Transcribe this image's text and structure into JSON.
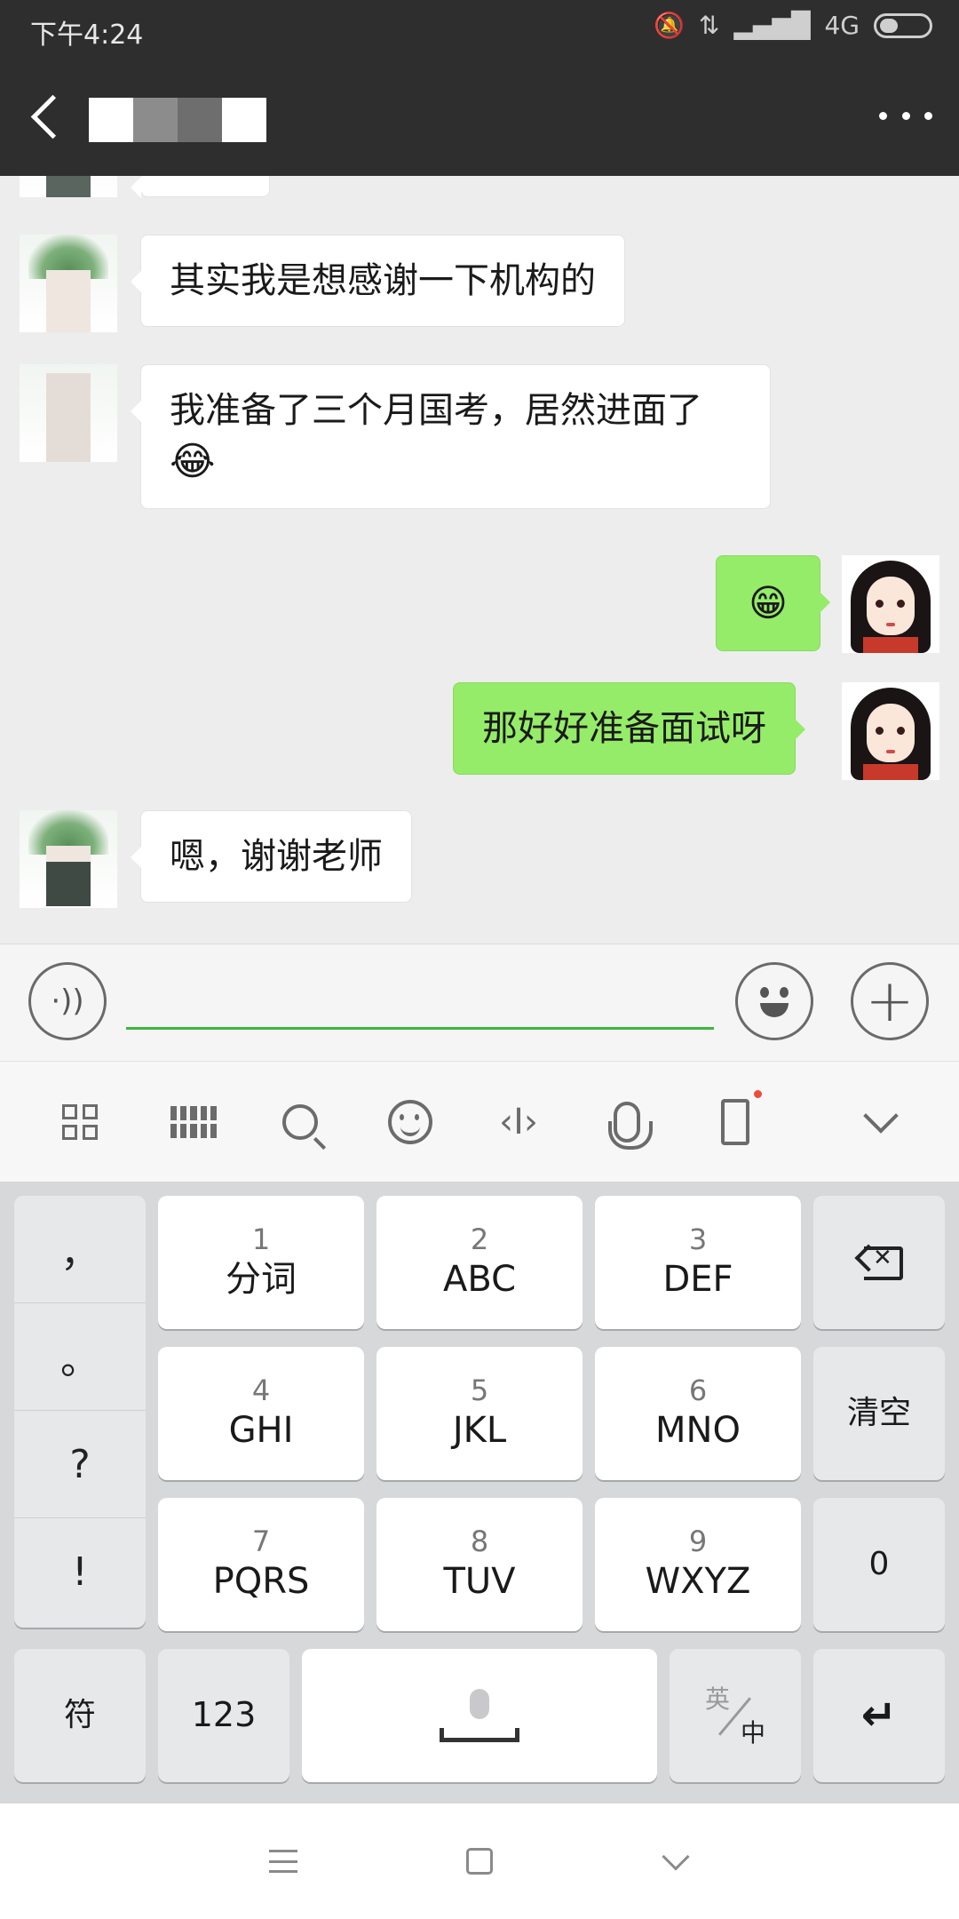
{
  "status_bar": {
    "time": "下午4:24",
    "network": "4G"
  },
  "title_bar": {
    "contact_name": "",
    "back_icon": "back-arrow-icon",
    "more_icon": "more-dots-icon"
  },
  "messages": [
    {
      "side": "left",
      "text": "其实我是想感谢一下机构的"
    },
    {
      "side": "left",
      "text": "我准备了三个月国考，居然进面了",
      "emoji": "😂"
    },
    {
      "side": "right",
      "text": "",
      "emoji": "😁"
    },
    {
      "side": "right",
      "text": "那好好准备面试呀"
    },
    {
      "side": "left",
      "text": "嗯，谢谢老师"
    }
  ],
  "input_bar": {
    "voice_icon": "voice-icon",
    "emoji_icon": "emoji-icon",
    "plus_icon": "plus-icon",
    "value": ""
  },
  "ime_toolbar": [
    "grid-menu-icon",
    "keyboard-icon",
    "search-icon",
    "emoji-face-icon",
    "cursor-icon",
    "microphone-icon",
    "calculator-icon",
    "collapse-chevron-icon"
  ],
  "keyboard": {
    "punctuation": [
      "，",
      "。",
      "?",
      "!"
    ],
    "keys": [
      {
        "num": "1",
        "label": "分词"
      },
      {
        "num": "2",
        "label": "ABC"
      },
      {
        "num": "3",
        "label": "DEF"
      },
      {
        "num": "4",
        "label": "GHI"
      },
      {
        "num": "5",
        "label": "JKL"
      },
      {
        "num": "6",
        "label": "MNO"
      },
      {
        "num": "7",
        "label": "PQRS"
      },
      {
        "num": "8",
        "label": "TUV"
      },
      {
        "num": "9",
        "label": "WXYZ"
      }
    ],
    "clear": "清空",
    "zero": "0",
    "symbol": "符",
    "num_mode": "123",
    "lang_en": "英",
    "lang_zh": "中",
    "enter": "↵"
  },
  "nav_bar": [
    "menu-icon",
    "home-icon",
    "back-chevron-icon"
  ],
  "colors": {
    "header": "#2e2e2e",
    "chat_bg": "#ededed",
    "sent_bubble": "#95ec69",
    "received_bubble": "#ffffff",
    "input_underline": "#3db63d",
    "badge_dot": "#f04a3a"
  }
}
